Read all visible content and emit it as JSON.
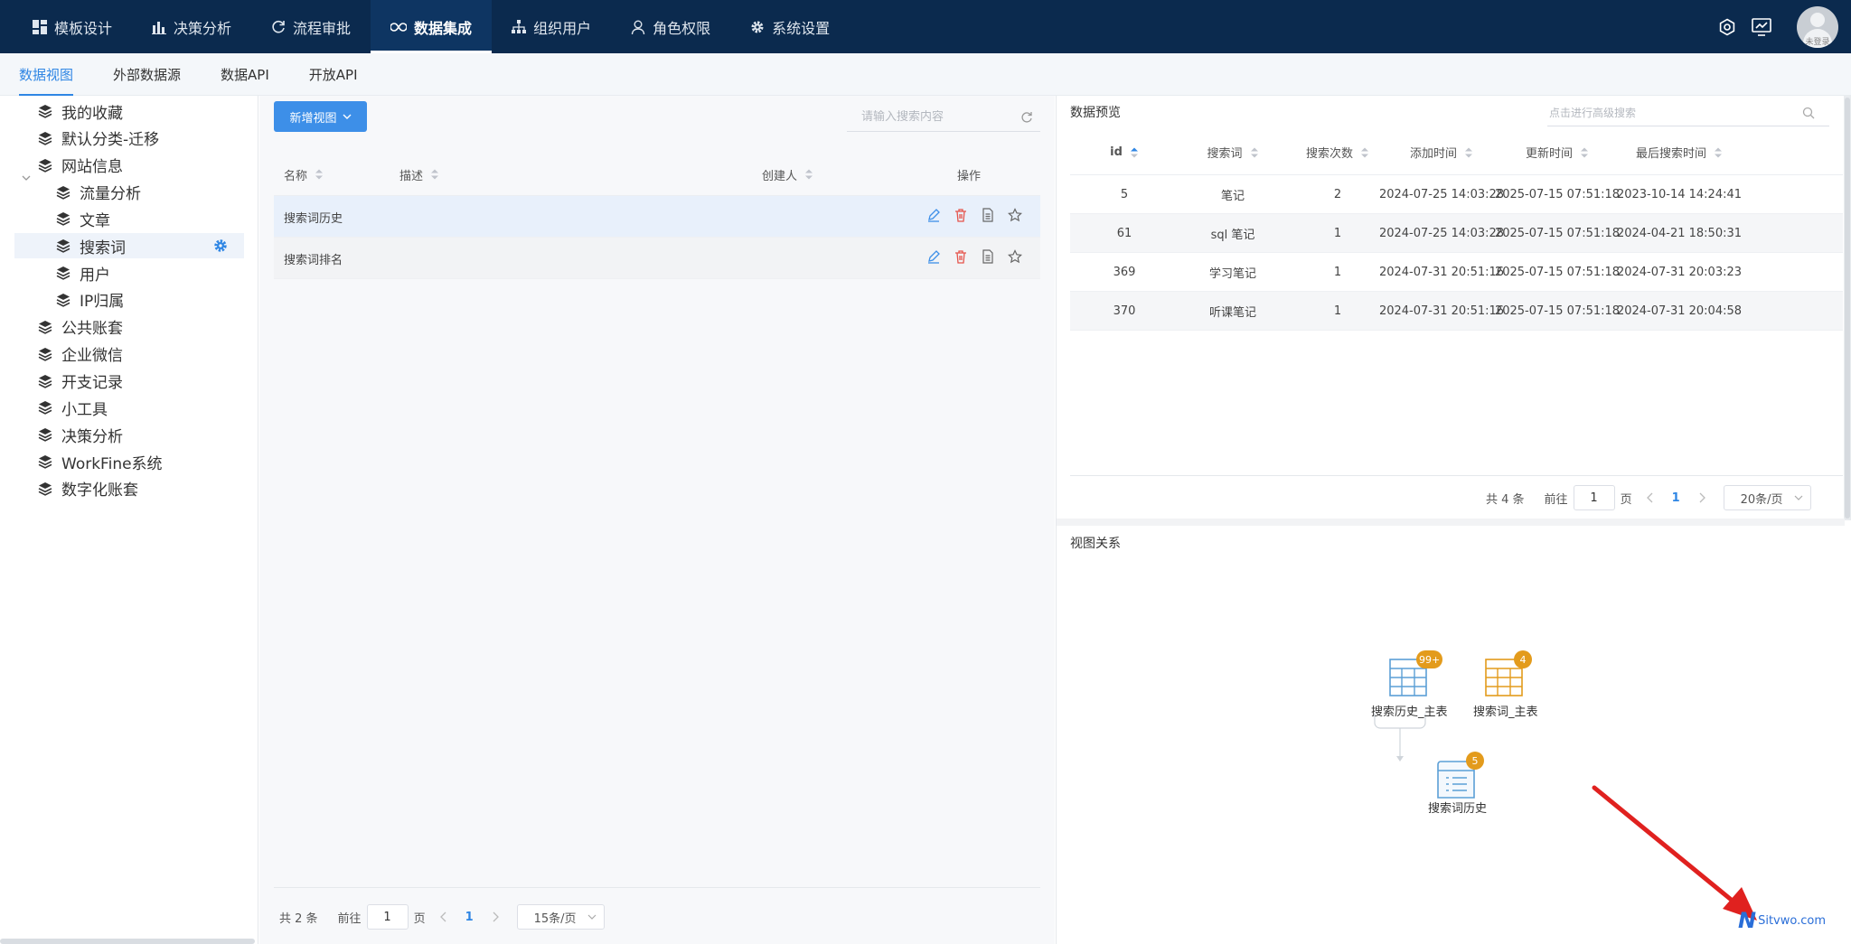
{
  "topnav": {
    "items": [
      {
        "label": "模板设计",
        "icon": "grid-icon"
      },
      {
        "label": "决策分析",
        "icon": "bar-chart-icon"
      },
      {
        "label": "流程审批",
        "icon": "refresh-icon"
      },
      {
        "label": "数据集成",
        "icon": "infinity-icon",
        "active": true
      },
      {
        "label": "组织用户",
        "icon": "org-chart-icon"
      },
      {
        "label": "角色权限",
        "icon": "user-icon"
      },
      {
        "label": "系统设置",
        "icon": "gear-icon"
      }
    ],
    "avatar_text": "未登录"
  },
  "subtabs": [
    "数据视图",
    "外部数据源",
    "数据API",
    "开放API"
  ],
  "sidebar": {
    "items": [
      {
        "label": "我的收藏"
      },
      {
        "label": "默认分类-迁移"
      },
      {
        "label": "网站信息",
        "expanded": true
      },
      {
        "label": "流量分析"
      },
      {
        "label": "文章"
      },
      {
        "label": "搜索词",
        "selected": true
      },
      {
        "label": "用户"
      },
      {
        "label": "IP归属"
      },
      {
        "label": "公共账套"
      },
      {
        "label": "企业微信"
      },
      {
        "label": "开支记录"
      },
      {
        "label": "小工具"
      },
      {
        "label": "决策分析"
      },
      {
        "label": "WorkFine系统"
      },
      {
        "label": "数字化账套"
      }
    ]
  },
  "middle": {
    "new_view_button": "新增视图",
    "search_placeholder": "请输入搜索内容",
    "columns": {
      "name": "名称",
      "desc": "描述",
      "creator": "创建人",
      "ops": "操作"
    },
    "rows": [
      {
        "name": "搜索词历史"
      },
      {
        "name": "搜索词排名"
      }
    ],
    "pager": {
      "total": "共 2 条",
      "goto": "前往",
      "page_input": "1",
      "page_unit": "页",
      "current": "1",
      "size": "15条/页"
    }
  },
  "preview": {
    "title": "数据预览",
    "adv_search_placeholder": "点击进行高级搜索",
    "columns": [
      "id",
      "搜索词",
      "搜索次数",
      "添加时间",
      "更新时间",
      "最后搜索时间"
    ],
    "rows": [
      [
        "5",
        "笔记",
        "2",
        "2024-07-25 14:03:28",
        "2025-07-15 07:51:18",
        "2023-10-14 14:24:41"
      ],
      [
        "61",
        "sql 笔记",
        "1",
        "2024-07-25 14:03:28",
        "2025-07-15 07:51:18",
        "2024-04-21 18:50:31"
      ],
      [
        "369",
        "学习笔记",
        "1",
        "2024-07-31 20:51:16",
        "2025-07-15 07:51:18",
        "2024-07-31 20:03:23"
      ],
      [
        "370",
        "听课笔记",
        "1",
        "2024-07-31 20:51:16",
        "2025-07-15 07:51:18",
        "2024-07-31 20:04:58"
      ]
    ],
    "pager": {
      "total": "共 4 条",
      "goto": "前往",
      "page_input": "1",
      "page_unit": "页",
      "current": "1",
      "size": "20条/页"
    }
  },
  "relations": {
    "title": "视图关系",
    "nodes": [
      {
        "label": "搜索历史_主表",
        "badge": "99+",
        "color": "#5b9fd6"
      },
      {
        "label": "搜索词_主表",
        "badge": "4",
        "color": "#e39b1c"
      },
      {
        "label": "搜索词历史",
        "badge": "5",
        "color": "#5b9fd6"
      }
    ]
  },
  "watermark": {
    "letter": "N",
    "text": "Sitvwo.com"
  }
}
